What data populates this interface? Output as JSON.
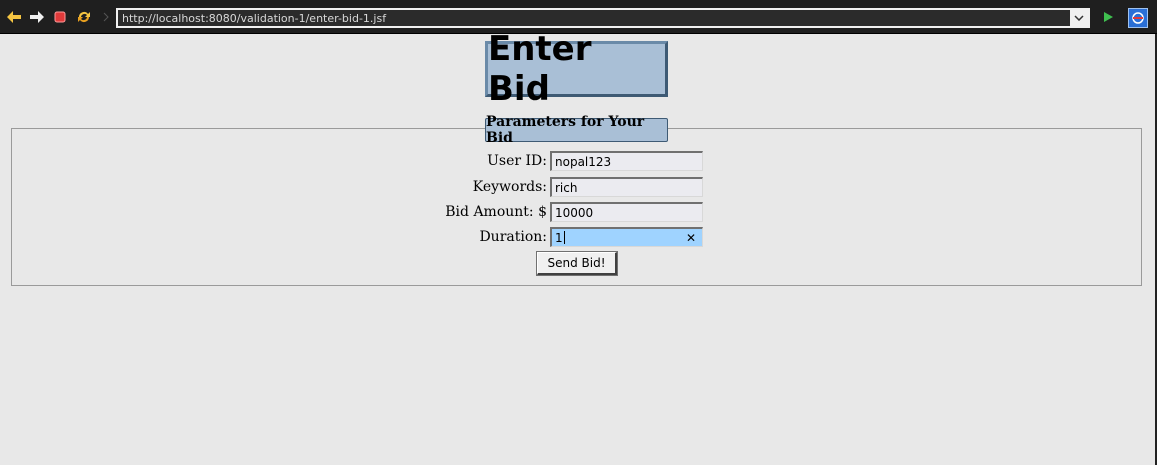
{
  "browser": {
    "url": "http://localhost:8080/validation-1/enter-bid-1.jsf",
    "icons": [
      "back-arrow-icon",
      "forward-arrow-icon",
      "stop-icon",
      "reload-icon",
      "go-icon",
      "browser-logo-icon"
    ]
  },
  "page": {
    "title": "Enter Bid",
    "legend": "Parameters for Your Bid",
    "fields": [
      {
        "label": "User ID:",
        "value": "nopal123"
      },
      {
        "label": "Keywords:",
        "value": "rich"
      },
      {
        "label": "Bid Amount: $",
        "value": "10000"
      },
      {
        "label": "Duration:",
        "value": "1"
      }
    ],
    "clear_symbol": "✕",
    "submit_label": "Send Bid!"
  },
  "colors": {
    "title_bg": "#a9bfd6",
    "active_field_bg": "#9fd3ff",
    "page_bg": "#e8e8e8"
  }
}
